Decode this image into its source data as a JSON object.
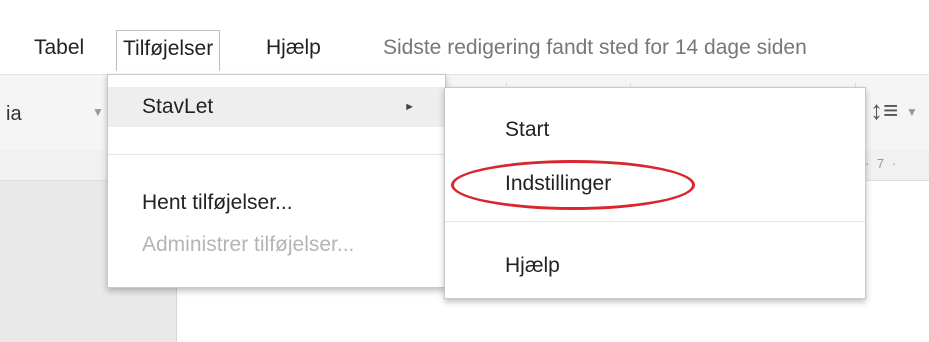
{
  "menubar": {
    "items": [
      "Tabel",
      "Tilføjelser",
      "Hjælp"
    ],
    "last_edit": "Sidste redigering fandt sted for 14 dage siden"
  },
  "toolbar": {
    "font_partial": "ia",
    "spacing_icon": "line-spacing-icon"
  },
  "ruler": {
    "ticks": "| · 7 ·"
  },
  "dropdown": {
    "items": [
      {
        "label": "StavLet",
        "has_submenu": true,
        "highlighted": true
      },
      {
        "label": "Hent tilføjelser...",
        "disabled": false
      },
      {
        "label": "Administrer tilføjelser...",
        "disabled": true
      }
    ]
  },
  "submenu": {
    "items": [
      "Start",
      "Indstillinger",
      "Hjælp"
    ]
  },
  "annotation": {
    "color": "#d8262c",
    "target": "Indstillinger"
  }
}
